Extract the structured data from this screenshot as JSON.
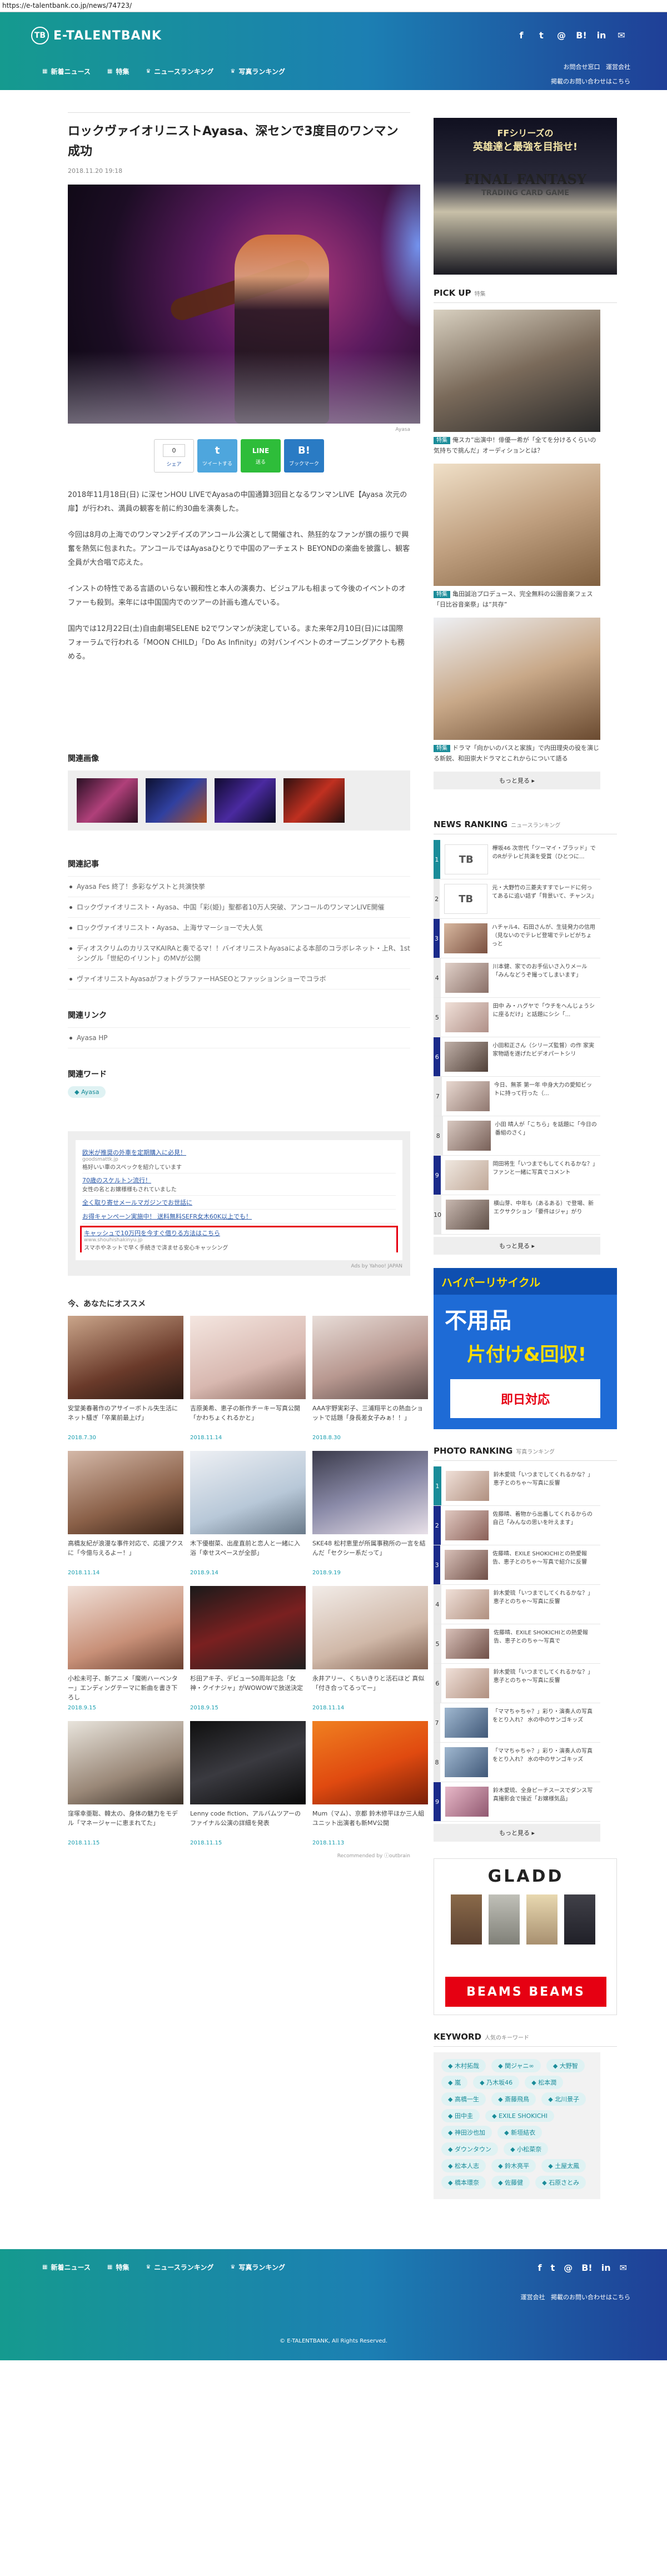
{
  "url": "https://e-talentbank.co.jp/news/74723/",
  "brand": {
    "logo_mark": "TB",
    "name": "E-TALENTBANK"
  },
  "header": {
    "nav": [
      {
        "label": "新着ニュース",
        "icon": "grid-icon"
      },
      {
        "label": "特集",
        "icon": "grid-icon"
      },
      {
        "label": "ニュースランキング",
        "icon": "crown-icon"
      },
      {
        "label": "写真ランキング",
        "icon": "crown-icon"
      }
    ],
    "social": [
      "f",
      "t",
      "@",
      "B!",
      "in",
      "✉"
    ],
    "links": [
      "お問合せ窓口",
      "運営会社",
      "掲載のお問い合わせはこちら"
    ]
  },
  "article": {
    "title": "ロックヴァイオリニストAyasa、深センで3度目のワンマン成功",
    "date": "2018.11.20 19:18",
    "photo_credit": "Ayasa",
    "share": {
      "count": "0",
      "count_label": "ツイート",
      "like_label": "シェア",
      "twitter_label": "ツイートする",
      "line_label": "送る",
      "hatena_label": "ブックマーク"
    },
    "paragraphs": [
      "2018年11月18日(日) に深センHOU LIVEでAyasaの中国通算3回目となるワンマンLIVE【Ayasa 次元の扉】が行われ、満員の観客を前に約30曲を演奏した。",
      "今回は8月の上海でのワンマン2デイズのアンコール公演として開催され、熱狂的なファンが旗の振りで興奮を熱気に包まれた。アンコールではAyasaひとりで中国のアーチェスト BEYONDの楽曲を披露し、観客全員が大合唱で応えた。",
      "インストの特性である言語のいらない親和性と本人の演奏力、ビジュアルも相まって今後のイベントのオファーも殺到。来年には中国国内でのツアーの計画も進んでいる。",
      "国内では12月22日(土)自由劇場SELENE b2でワンマンが決定している。また来年2月10日(日)には国際フォーラムで行われる「MOON CHILD」「Do As Infinity」の対バンイベントのオープニングアクトも務める。"
    ]
  },
  "sections": {
    "gallery_title": "関連画像",
    "related_title": "関連記事",
    "links_title": "関連リンク",
    "words_title": "関連ワード",
    "reco_title": "今、あなたにオススメ"
  },
  "related_articles": [
    "Ayasa Fes 終了！多彩なゲストと共演快挙",
    "ロックヴァイオリニスト・Ayasa、中国「彩(姫)」聖都者10万人突破、アンコールのワンマンLIVE開催",
    "ロックヴァイオリニスト・Ayasa、上海サマーショーで大人気",
    "ディオスクリムのカリスマKAIRAと奏でるマ！！バイオリニストAyasaによる本部のコラボレネット・上R、1st シングル「世紀のイリント」のMVが公開",
    "ヴァイオリニストAyasaがフォトグラファーHASEOとファッションショーでコラボ"
  ],
  "related_links": [
    "Ayasa HP"
  ],
  "related_words": [
    "Ayasa"
  ],
  "ad_links": [
    {
      "title": "欧米が推奨の外車を定期購入に必見！",
      "url": "goodsmattk.jp",
      "desc": "格好いい車のスペックを紹介しています"
    },
    {
      "title": "70歳のスケルトン流行！",
      "url": "",
      "desc": "女性の名とお嬢様様もされていました"
    },
    {
      "title": "全く取り寄せメールマガジンでお世話に",
      "url": "",
      "desc": ""
    },
    {
      "title": "お得キャンペーン実施中！ 送料無料SEFR女木60K以上でも！",
      "url": "",
      "desc": ""
    },
    {
      "title": "キャッシュで10万円を今すぐ借りる方法はこちら",
      "url": "www.shouhishakinyu.jp",
      "desc": "スマホやネットで早く手続きで済ませる安心キャッシング",
      "highlight": true
    }
  ],
  "ads_by": "Ads by Yahoo! JAPAN",
  "reco": [
    {
      "text": "安堂美春著作のアサイーボトル失生活にネット騒ぎ「卒業前最上げ」",
      "date": "2018.7.30"
    },
    {
      "text": "吉原美希、恵子の新作チーキー写真公開「かわちょくれるかと」",
      "date": "2018.11.14"
    },
    {
      "text": "AAA宇野実彩子、三浦翔平との熱血ショットで話題「身長差女子みぁ！！」",
      "date": "2018.8.30"
    },
    {
      "text": "高橋友紀が浪漫な事件対応で、応援アクスに「今億与えるよー！」",
      "date": "2018.11.14"
    },
    {
      "text": "木下優樹菜、出産直前と恋人と一緒に入浴「幸せスペースが全部」",
      "date": "2018.9.14"
    },
    {
      "text": "SKE48 松村恵里が所属事務所の一言を結んだ「セクシー系だって」",
      "date": "2018.9.19"
    },
    {
      "text": "小松未可子、新アニメ「魔術ハーベンター」エンディングテーマに新曲を書き下ろし",
      "date": "2018.9.15"
    },
    {
      "text": "杉田アキ子、デビュー50周年記念「女神・クイナジャ」がWOWOWで放送決定",
      "date": "2018.9.15"
    },
    {
      "text": "永井アリー、くちいきりと活石ほど 真似「付き合ってるってー」",
      "date": "2018.11.14"
    },
    {
      "text": "窪塚幸亜聡、韓太の、身体の魅力をモデル「マネージャーに恵まれてた」",
      "date": "2018.11.15"
    },
    {
      "text": "Lenny code fiction、アルバムツアーのファイナル公演の詳細を発表",
      "date": "2018.11.15"
    },
    {
      "text": "Mum（マム）、京都 鈴木修平ほか三人組ユニット出演者も新MV公開",
      "date": "2018.11.13"
    }
  ],
  "reco_credit": "Recommended by ⓘoutbrain",
  "sidebar": {
    "pickup_title": "PICK UP",
    "pickup_sub": "特集",
    "pickups": [
      {
        "badge": "特集",
        "text": "俺スカ”出演中！俳優一希が「全てを分けるくらいの気持ちで挑んだ」オーディションとは？"
      },
      {
        "badge": "特集",
        "text": "亀田誠治プロデュース、完全無料の公園音楽フェス「日比谷音楽祭」は”共存”"
      },
      {
        "badge": "特集",
        "text": "ドラマ「向かいのバスと家族」で内田理央の役を演じる新鋭、和田崇大ドラマとこれからについて語る"
      }
    ],
    "more_label": "もっと見る ▸",
    "news_title": "NEWS RANKING",
    "news_sub": "ニュースランキング",
    "news_ranking": [
      "欅坂46 次世代「ツーマイ・ブラッド」でのRがテレビ共演を受賞（ひとつに...",
      "元・大野竹の三菱夫すすでレードに何ってあるに追い詰ず「背景いて、チャンス」",
      "ハチャル4、石田さんが、生徒発力の信用（見ないのでテレビ登場でテレビがちょっと",
      "川本健、家でのお手伝いさ入りメール「みんなどうぞ撮ってしまいます」",
      "田中 み・ハグヤで「ウチをへんじょうシに座るだけ」と話題にシシ「...",
      "小田和正さん（シリーズ監督）の作 家実家物語を遂げたビデオパートシリ",
      "今日、無茶 第一年 中身大力の愛知ビットに持って行った（...",
      "小田 晴人が「こちら」を話題に「今日の番組のさく」",
      "岡田将生「いつまでもしてくれるかな？」ファンと一緒に写真でコメント",
      "横山芽、中年も（あるある）で登場、新エクサクション「要件はジャ」がり"
    ],
    "photo_title": "PHOTO RANKING",
    "photo_sub": "写真ランキング",
    "photo_ranking": [
      "鈴木愛琉「いつまでしてくれるかな？」恵子とのちゃ〜写真に反響",
      "佐藤晴、着物から出番してくれるからの自己「みんなの思いを叶えます」",
      "佐藤晴、EXILE SHOKICHIとの熱愛報告、恵子とのちゃ〜写真で紹介に反響",
      "鈴木愛琉「いつまでしてくれるかな？」恵子とのちゃ〜写真に反響",
      "佐藤晴、EXILE SHOKICHIとの熱愛報告、恵子とのちゃ〜写真で",
      "鈴木愛琉「いつまでしてくれるかな？」恵子とのちゃ〜写真に反響",
      "「ママちゃちゃ？」彩り・演奏人の写真をとり入れ？ 水の中のサンゴキッズ",
      "「ママちゃちゃ？」彩り・演奏人の写真をとり入れ？ 水の中のサンゴキッズ",
      "鈴木愛琉、全身ピーチスースでダンス写真撮影会で接近「お嬢様気品」"
    ],
    "keyword_title": "KEYWORD",
    "keyword_sub": "人気のキーワード",
    "keywords": [
      "木村拓哉",
      "関ジャニ∞",
      "大野智",
      "嵐",
      "乃木坂46",
      "松本潤",
      "高橋一生",
      "斎藤飛鳥",
      "北川景子",
      "田中圭",
      "EXILE SHOKICHI",
      "神田沙也加",
      "新垣結衣",
      "ダウンタウン",
      "小松菜奈",
      "松本人志",
      "鈴木亮平",
      "土屋太鳳",
      "橋本環奈",
      "佐藤健",
      "石原さとみ"
    ]
  },
  "side_ads": {
    "top_line1": "FFシリーズの",
    "top_line2": "英雄達と最強を目指せ!",
    "top_line3": "FINAL FANTASY",
    "top_line4": "TRADING CARD GAME",
    "mid_band": "ハイパーリサイクル",
    "mid_big": "不用品",
    "mid_big2": "片付け&回収!",
    "mid_box": "即日対応",
    "gladd": "GLADD",
    "gladd_bar": "BEAMS BEAMS"
  },
  "footer": {
    "copyright": "© E-TALENTBANK, All Rights Reserved."
  },
  "colors": {
    "brand_teal": "#1a8c99",
    "brand_blue": "#1f3f97",
    "rank_navy": "#1a2a8a",
    "ad_highlight": "#e60012"
  }
}
